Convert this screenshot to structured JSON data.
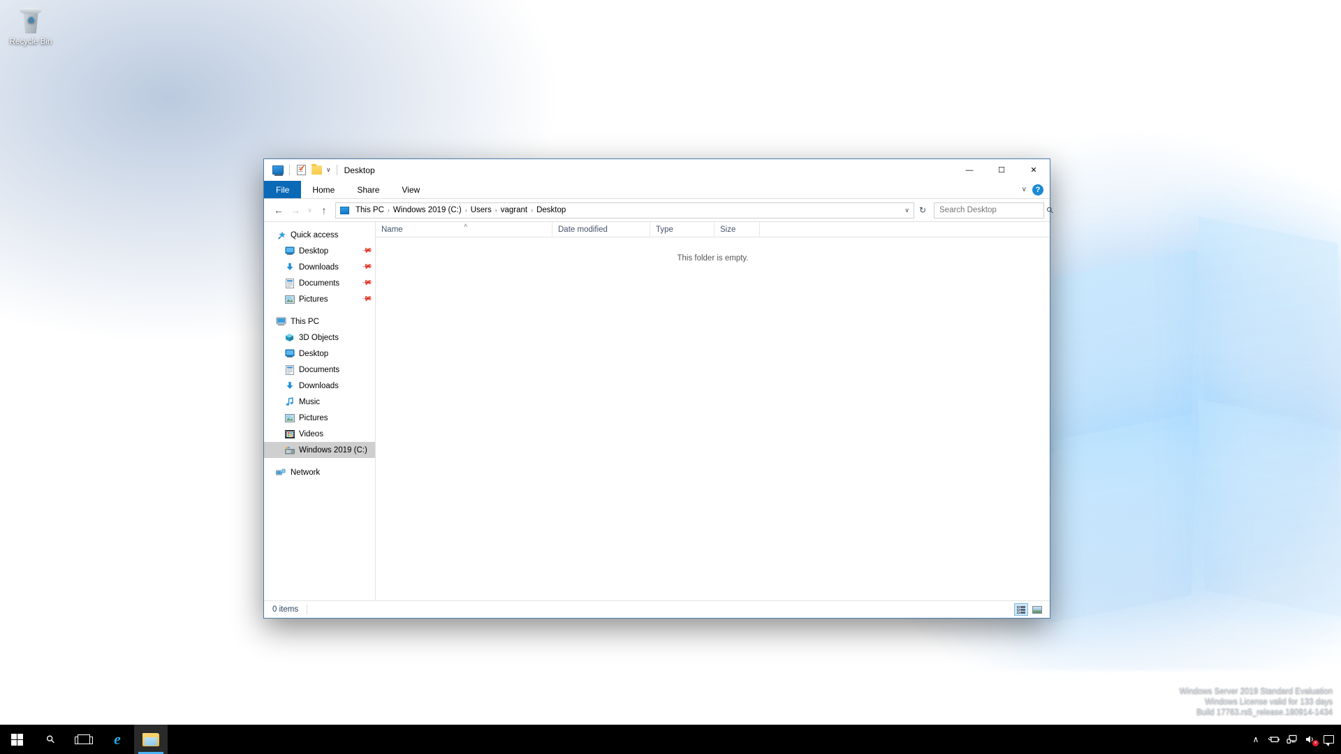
{
  "desktop": {
    "icons": [
      {
        "label": "Recycle Bin",
        "icon": "recycle-bin-icon"
      }
    ],
    "watermark": {
      "line1": "Windows Server 2019 Standard Evaluation",
      "line2": "Windows License valid for 133 days",
      "line3": "Build 17763.rs5_release.180914-1434"
    }
  },
  "explorer": {
    "title": "Desktop",
    "quick_access_toolbar": [
      {
        "name": "properties-icon",
        "tooltip": "Properties"
      },
      {
        "name": "new-folder-icon",
        "tooltip": "New folder"
      },
      {
        "name": "customize-qat-icon",
        "tooltip": "Customize Quick Access Toolbar"
      }
    ],
    "window_controls": {
      "minimize": "—",
      "maximize": "☐",
      "close": "✕"
    },
    "ribbon": {
      "tabs": [
        {
          "label": "File",
          "active_style": "file"
        },
        {
          "label": "Home",
          "active_style": "normal"
        },
        {
          "label": "Share",
          "active_style": "normal"
        },
        {
          "label": "View",
          "active_style": "normal"
        }
      ],
      "expand_label": "∨",
      "help_label": "?"
    },
    "address_bar": {
      "back": "←",
      "forward": "→",
      "recent": "∨",
      "up": "↑",
      "breadcrumbs": [
        "This PC",
        "Windows 2019 (C:)",
        "Users",
        "vagrant",
        "Desktop"
      ],
      "separator": "›",
      "dropdown": "∨",
      "refresh": "↻"
    },
    "search": {
      "placeholder": "Search Desktop",
      "value": "",
      "icon": "search-icon"
    },
    "navigation_pane": {
      "groups": [
        {
          "header": {
            "label": "Quick access",
            "icon": "star-pin-icon"
          },
          "items": [
            {
              "label": "Desktop",
              "icon": "desktop-icon",
              "pinned": true
            },
            {
              "label": "Downloads",
              "icon": "downloads-icon",
              "pinned": true
            },
            {
              "label": "Documents",
              "icon": "documents-icon",
              "pinned": true
            },
            {
              "label": "Pictures",
              "icon": "pictures-icon",
              "pinned": true
            }
          ]
        },
        {
          "header": {
            "label": "This PC",
            "icon": "this-pc-icon"
          },
          "items": [
            {
              "label": "3D Objects",
              "icon": "3d-objects-icon",
              "pinned": false
            },
            {
              "label": "Desktop",
              "icon": "desktop-icon",
              "pinned": false
            },
            {
              "label": "Documents",
              "icon": "documents-icon",
              "pinned": false
            },
            {
              "label": "Downloads",
              "icon": "downloads-icon",
              "pinned": false
            },
            {
              "label": "Music",
              "icon": "music-icon",
              "pinned": false
            },
            {
              "label": "Pictures",
              "icon": "pictures-icon",
              "pinned": false
            },
            {
              "label": "Videos",
              "icon": "videos-icon",
              "pinned": false
            },
            {
              "label": "Windows 2019 (C:)",
              "icon": "drive-icon",
              "pinned": false,
              "selected": true
            }
          ]
        },
        {
          "header": {
            "label": "Network",
            "icon": "network-icon"
          },
          "items": []
        }
      ]
    },
    "file_list": {
      "columns": [
        {
          "label": "Name",
          "sorted": true,
          "sort_dir": "asc"
        },
        {
          "label": "Date modified",
          "sorted": false
        },
        {
          "label": "Type",
          "sorted": false
        },
        {
          "label": "Size",
          "sorted": false
        }
      ],
      "sort_caret": "˄",
      "empty_message": "This folder is empty.",
      "rows": []
    },
    "status_bar": {
      "item_count": "0 items",
      "views": [
        {
          "name": "details-view-button",
          "active": true
        },
        {
          "name": "large-icons-view-button",
          "active": false
        }
      ]
    }
  },
  "taskbar": {
    "buttons": [
      {
        "name": "start-button",
        "icon": "windows-logo-icon"
      },
      {
        "name": "search-button",
        "icon": "search-icon"
      },
      {
        "name": "task-view-button",
        "icon": "task-view-icon"
      },
      {
        "name": "internet-explorer-button",
        "icon": "internet-explorer-icon",
        "glyph": "e"
      },
      {
        "name": "file-explorer-button",
        "icon": "file-explorer-icon",
        "active": true
      }
    ],
    "tray": [
      {
        "name": "show-hidden-icons-button",
        "icon": "chevron-up-icon",
        "glyph": "∧"
      },
      {
        "name": "power-icon",
        "icon": "battery-icon",
        "glyph": "🔌"
      },
      {
        "name": "network-icon",
        "icon": "network-icon",
        "glyph": "🖥"
      },
      {
        "name": "volume-icon",
        "icon": "speaker-muted-icon",
        "glyph": "🔈",
        "muted": true,
        "mute_mark": "×"
      },
      {
        "name": "action-center-button",
        "icon": "notification-icon"
      }
    ]
  },
  "colors": {
    "accent": "#0b69b6",
    "taskbar": "#000000",
    "selection": "#cfcfcf",
    "help_blue": "#1a8ad6",
    "active_underline": "#4cb3f5"
  }
}
